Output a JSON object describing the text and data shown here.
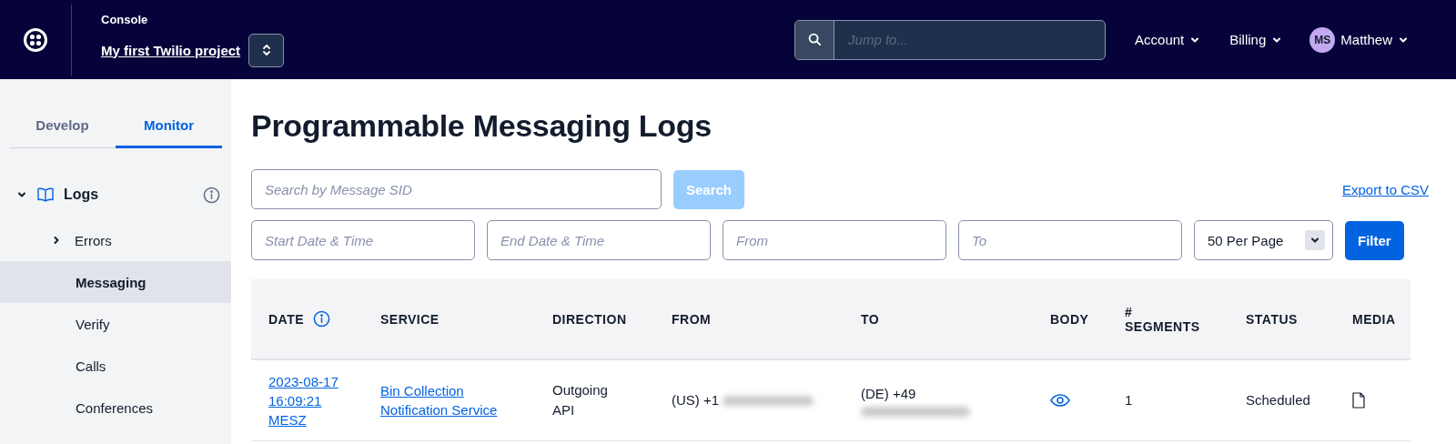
{
  "topbar": {
    "console_label": "Console",
    "project": "My first Twilio project",
    "search": {
      "placeholder": "Jump to..."
    },
    "menus": [
      "Account",
      "Billing"
    ],
    "user": {
      "initials": "MS",
      "name": "Matthew"
    }
  },
  "sidebar": {
    "tabs": [
      {
        "label": "Develop",
        "selected": false
      },
      {
        "label": "Monitor",
        "selected": true
      }
    ],
    "nav": [
      {
        "label": "Logs",
        "expanded": true,
        "children": [
          {
            "label": "Errors",
            "kind": "folder",
            "expanded": false,
            "selected": false
          },
          {
            "label": "Messaging",
            "kind": "page",
            "selected": true
          },
          {
            "label": "Verify",
            "kind": "page",
            "selected": false
          },
          {
            "label": "Calls",
            "kind": "page",
            "selected": false
          },
          {
            "label": "Conferences",
            "kind": "page",
            "selected": false
          }
        ]
      }
    ]
  },
  "page": {
    "title": "Programmable Messaging Logs",
    "search": {
      "placeholder": "Search by Message SID",
      "button": "Search",
      "disabled": true
    },
    "export_link": "Export to CSV",
    "filters": [
      {
        "placeholder": "Start Date & Time"
      },
      {
        "placeholder": "End Date & Time"
      },
      {
        "placeholder": "From"
      },
      {
        "placeholder": "To"
      }
    ],
    "per_page": "50 Per Page",
    "filter_button": "Filter",
    "table": {
      "columns": [
        {
          "label": "DATE",
          "info": true
        },
        {
          "label": "SERVICE",
          "info": false
        },
        {
          "label": "DIRECTION",
          "info": false
        },
        {
          "label": "FROM",
          "info": false
        },
        {
          "label": "TO",
          "info": false
        },
        {
          "label": "BODY",
          "info": false
        },
        {
          "label": "# SEGMENTS",
          "info": false
        },
        {
          "label": "STATUS",
          "info": false
        },
        {
          "label": "MEDIA",
          "info": false
        }
      ],
      "rows": [
        {
          "date": "2023-08-17 16:09:21 MESZ",
          "service": "Bin Collection Notification Service",
          "direction": "Outgoing API",
          "from": "(US) +1",
          "to": "(DE) +49",
          "segments": "1",
          "status": "Scheduled"
        }
      ]
    }
  }
}
